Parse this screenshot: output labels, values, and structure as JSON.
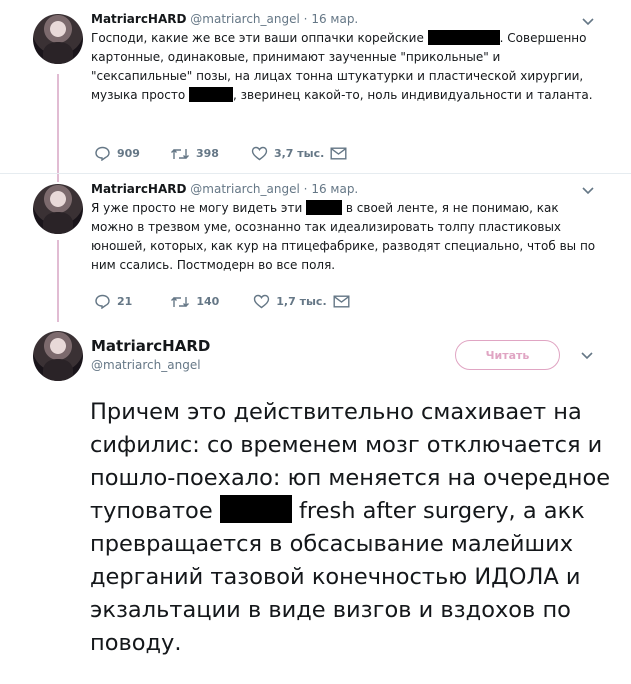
{
  "tweets": [
    {
      "name": "MatriarcHARD",
      "handle": "@matriarch_angel",
      "separator": "·",
      "date": "16 мар.",
      "text_before": "Господи, какие же все эти ваши оппачки корейские ",
      "text_middle": ". Совершенно картонные, одинаковые, принимают заученные \"прикольные\" и \"сексапильные\" позы, на лицах тонна штукатурки и пластической хирургии, музыка просто ",
      "text_after": ", зверинец какой-то, ноль индивидуальности и таланта.",
      "replies": "909",
      "retweets": "398",
      "likes": "3,7 тыс."
    },
    {
      "name": "MatriarcHARD",
      "handle": "@matriarch_angel",
      "separator": "·",
      "date": "16 мар.",
      "text_before": "Я уже просто не могу видеть эти ",
      "text_after": " в своей ленте, я не понимаю, как можно в трезвом уме, осознанно так идеализировать толпу пластиковых юношей, которых, как кур на птицефабрике, разводят специально, чтоб вы по ним ссались. Постмодерн во все поля.",
      "replies": "21",
      "retweets": "140",
      "likes": "1,7 тыс."
    }
  ],
  "main_tweet": {
    "name": "MatriarcHARD",
    "handle": "@matriarch_angel",
    "follow_label": "Читать",
    "text_before": "Причем это действительно смахивает на сифилис: со временем мозг отключается и пошло-поехало: юп меняется на очередное туповатое ",
    "text_after": " fresh after surgery, а акк превращается в обсасывание малейших дерганий тазовой конечностью ИДОЛА и экзальтации в виде визгов и вздохов по поводу."
  },
  "icons": {
    "reply": "reply-icon",
    "retweet": "retweet-icon",
    "like": "heart-icon",
    "dm": "envelope-icon",
    "more": "chevron-down-icon"
  },
  "colors": {
    "thread_line": "#e1bcd3",
    "follow_accent": "#e0a5c3",
    "secondary_text": "#657786"
  }
}
